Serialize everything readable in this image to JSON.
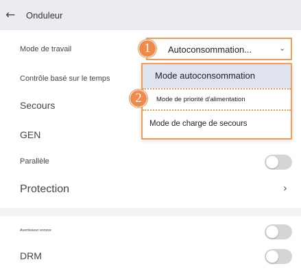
{
  "header": {
    "back_icon": "←",
    "title": "Onduleur"
  },
  "settings": {
    "work_mode_label": "Mode de travail",
    "time_control_label": "Contrôle basé sur le temps",
    "backup_label": "Secours",
    "gen_label": "GEN",
    "parallel_label": "Parallèle",
    "protection_label": "Protection",
    "buzzer_label": "Avertisseur sonore",
    "drm_label": "DRM"
  },
  "toggles": {
    "parallel_on": false,
    "buzzer_on": false,
    "drm_on": false
  },
  "work_mode_select": {
    "value": "Autoconsommation...",
    "chevron": "⌄"
  },
  "dropdown": {
    "options": [
      {
        "label": "Mode autoconsommation",
        "selected": true
      },
      {
        "label": "Mode de priorité d'alimentation",
        "selected": false
      },
      {
        "label": "Mode de charge de secours",
        "selected": false
      }
    ]
  },
  "callouts": {
    "badge_1": "1",
    "badge_2": "2"
  },
  "icons": {
    "chevron_right": "›"
  },
  "colors": {
    "accent": "#ef9a55",
    "badge": "#f08a4b",
    "selected_bg": "#dfe3ef",
    "toggle_off": "#d5d5d8",
    "header_bg": "#eaecef"
  }
}
